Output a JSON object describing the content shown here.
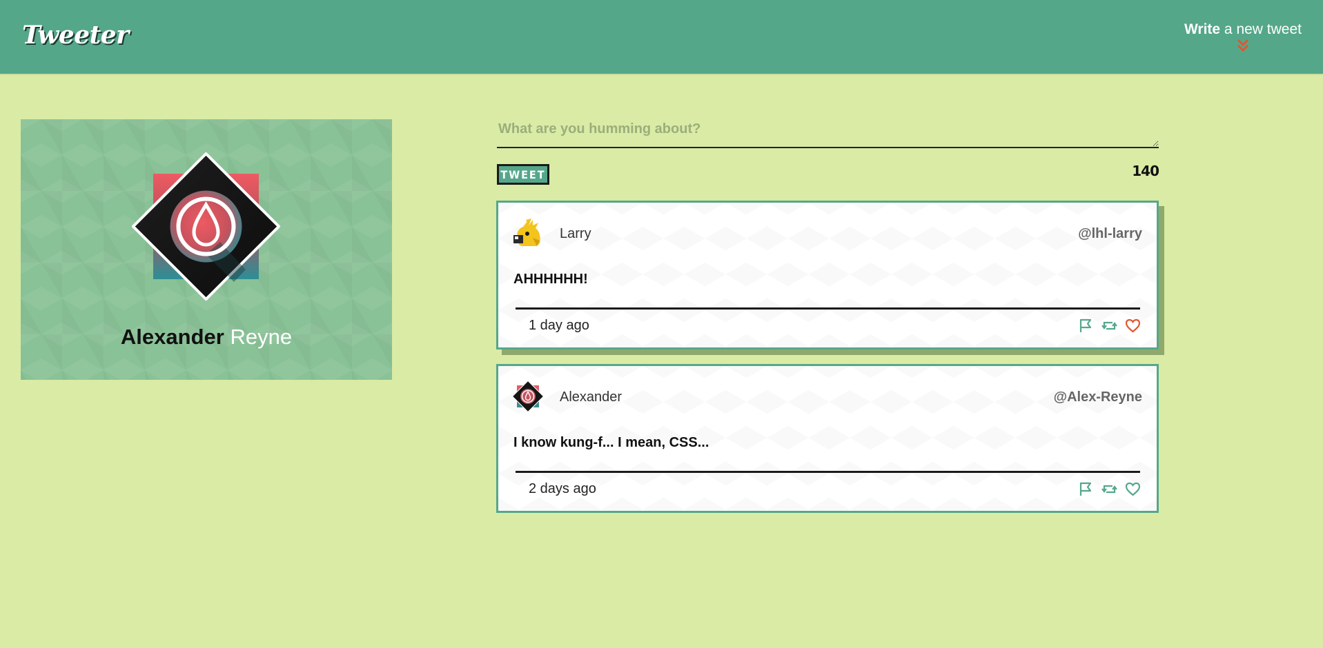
{
  "nav": {
    "logo": "Tweeter",
    "compose_toggle_strong": "Write",
    "compose_toggle_rest": " a new tweet"
  },
  "profile": {
    "first_name": "Alexander",
    "last_name": "Reyne"
  },
  "compose": {
    "placeholder": "What are you humming about?",
    "button_label": "TWEET",
    "char_count": "140"
  },
  "tweets": [
    {
      "name": "Larry",
      "handle": "@lhl-larry",
      "text": "AHHHHHH!",
      "time": "1 day ago",
      "liked": true
    },
    {
      "name": "Alexander",
      "handle": "@Alex-Reyne",
      "text": "I know kung-f... I mean, CSS...",
      "time": "2 days ago",
      "liked": false
    }
  ],
  "colors": {
    "background": "#d9eba5",
    "nav": "#55a78a",
    "accent": "#55a78a",
    "like_active": "#e2562f",
    "profile_card": "#8ac297"
  },
  "icons": {
    "flag": "flag-icon",
    "retweet": "retweet-icon",
    "like": "heart-icon",
    "chevron": "double-chevron-down-icon"
  }
}
